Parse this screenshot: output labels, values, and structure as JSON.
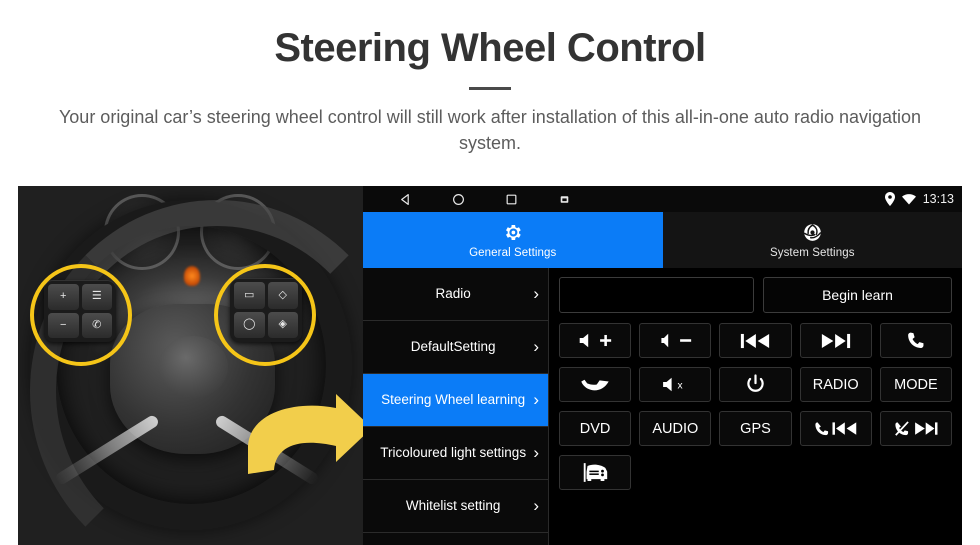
{
  "header": {
    "title": "Steering Wheel Control",
    "subtitle": "Your original car’s steering wheel control will still work after installation of this all-in-one auto radio navigation system."
  },
  "photo": {
    "alt_label": "car-steering-wheel-photo",
    "highlight_color": "#F5C518",
    "arrow_color": "#F2CE4B",
    "wheel_buttons_left": [
      "+",
      "☰",
      "−",
      "✆"
    ],
    "wheel_buttons_right": [
      "▭",
      "◇",
      "◯",
      "◈"
    ]
  },
  "android": {
    "statusbar": {
      "nav": [
        "back-icon",
        "home-icon",
        "recents-icon",
        "screenshot-icon"
      ],
      "location_icon": "location-pin-icon",
      "wifi_icon": "wifi-icon",
      "time": "13:13"
    },
    "tabs": [
      {
        "label": "General Settings",
        "icon": "gear-icon",
        "active": true
      },
      {
        "label": "System Settings",
        "icon": "system-swirl-icon",
        "active": false
      }
    ],
    "menu": [
      {
        "label": "Radio",
        "active": false
      },
      {
        "label": "DefaultSetting",
        "active": false
      },
      {
        "label": "Steering Wheel learning",
        "active": true
      },
      {
        "label": "Tricoloured light settings",
        "active": false
      },
      {
        "label": "Whitelist setting",
        "active": false
      }
    ],
    "content": {
      "learn_field_value": "",
      "learn_field_placeholder": "",
      "begin_button": "Begin learn",
      "buttons": [
        {
          "id": "vol-up",
          "icon": "speaker-plus-icon",
          "label": ""
        },
        {
          "id": "vol-down",
          "icon": "speaker-minus-icon",
          "label": ""
        },
        {
          "id": "prev-track",
          "icon": "previous-track-icon",
          "label": ""
        },
        {
          "id": "next-track",
          "icon": "next-track-icon",
          "label": ""
        },
        {
          "id": "call-answer",
          "icon": "phone-icon",
          "label": ""
        },
        {
          "id": "call-hangup",
          "icon": "phone-hangup-icon",
          "label": ""
        },
        {
          "id": "mute",
          "icon": "speaker-mute-icon",
          "label": ""
        },
        {
          "id": "power",
          "icon": "power-icon",
          "label": ""
        },
        {
          "id": "radio",
          "icon": "",
          "label": "RADIO"
        },
        {
          "id": "mode",
          "icon": "",
          "label": "MODE"
        },
        {
          "id": "dvd",
          "icon": "",
          "label": "DVD"
        },
        {
          "id": "audio",
          "icon": "",
          "label": "AUDIO"
        },
        {
          "id": "gps",
          "icon": "",
          "label": "GPS"
        },
        {
          "id": "call-prev",
          "icon": "phone-previous-icon",
          "label": ""
        },
        {
          "id": "call-off-next",
          "icon": "phone-off-next-icon",
          "label": ""
        },
        {
          "id": "car-view",
          "icon": "car-front-icon",
          "label": ""
        }
      ]
    },
    "colors": {
      "accent_blue": "#0B7CF7",
      "panel_black": "#000000",
      "button_border": "#333333"
    }
  }
}
